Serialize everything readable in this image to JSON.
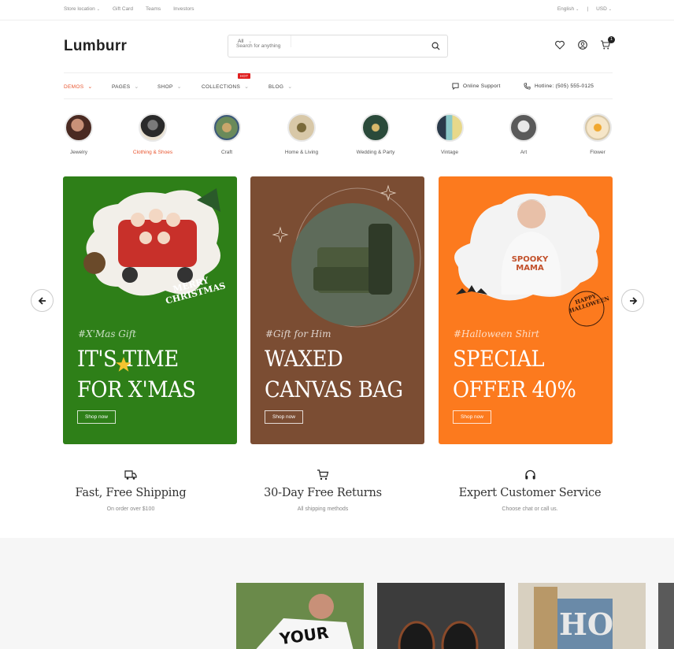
{
  "topbar": {
    "links": [
      "Store location",
      "Gift Card",
      "Teams",
      "Investors"
    ],
    "language": "English",
    "currency": "USD"
  },
  "header": {
    "logo": "Lumburr",
    "search": {
      "category": "All",
      "placeholder": "Search for anything"
    },
    "cart_count": "1"
  },
  "nav": {
    "items": [
      "DEMOS",
      "PAGES",
      "SHOP",
      "COLLECTIONS",
      "BLOG"
    ],
    "hot_badge": "HOT",
    "support": "Online Support",
    "hotline": "Hotline: (505) 555-0125"
  },
  "categories": [
    {
      "label": "Jewelry"
    },
    {
      "label": "Clothing & Shoes"
    },
    {
      "label": "Craft"
    },
    {
      "label": "Home & Living"
    },
    {
      "label": "Wedding & Party"
    },
    {
      "label": "Vintage"
    },
    {
      "label": "Art"
    },
    {
      "label": "Flower"
    }
  ],
  "banners": [
    {
      "tag": "#X'Mas Gift",
      "line1": "IT'S TIME",
      "line2": "FOR X'MAS",
      "button": "Shop now",
      "bg": "#2e7f18",
      "sticker": "MERRY CHRISTMAS"
    },
    {
      "tag": "#Gift for Him",
      "line1": "WAXED",
      "line2": "CANVAS BAG",
      "button": "Shop now",
      "bg": "#7b4d33"
    },
    {
      "tag": "#Halloween Shirt",
      "line1": "SPECIAL",
      "line2": "OFFER 40%",
      "button": "Shop now",
      "bg": "#fc7a1e",
      "shirt": "SPOOKY MAMA",
      "sticker": "HAPPY HALLOWEEN"
    }
  ],
  "features": [
    {
      "title": "Fast, Free Shipping",
      "subtitle": "On order over $100",
      "icon": "truck-icon"
    },
    {
      "title": "30-Day Free Returns",
      "subtitle": "All shipping methods",
      "icon": "cart-icon"
    },
    {
      "title": "Expert Customer Service",
      "subtitle": "Choose chat or call us.",
      "icon": "headset-icon"
    }
  ],
  "products": [
    {
      "text": "YOUR"
    },
    {
      "text": ""
    },
    {
      "text": "HO"
    }
  ],
  "colors": {
    "accent": "#e8542e",
    "hot": "#e02020"
  }
}
